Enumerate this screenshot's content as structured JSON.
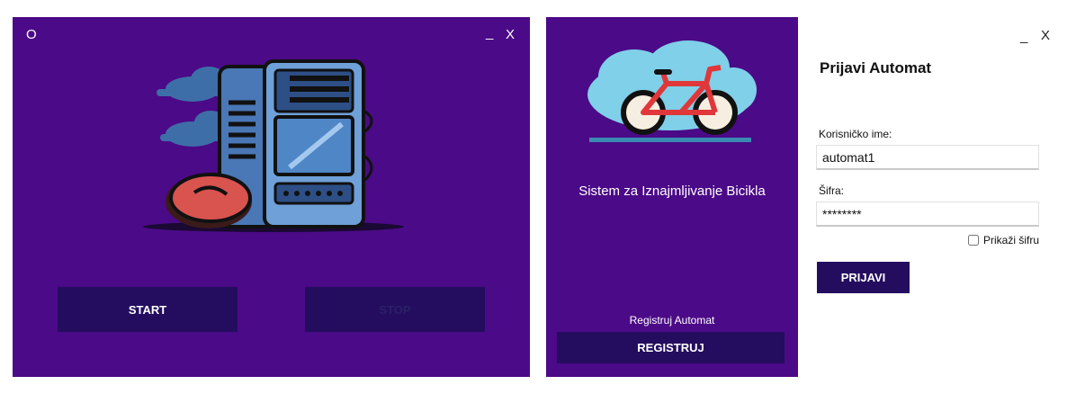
{
  "server_window": {
    "icon_label": "O",
    "minimize": "_",
    "close": "X",
    "start_label": "START",
    "stop_label": "STOP"
  },
  "brand_panel": {
    "title": "Sistem za Iznajmljivanje Bicikla",
    "register_caption": "Registruj Automat",
    "register_button": "REGISTRUJ"
  },
  "login": {
    "minimize": "_",
    "close": "X",
    "heading": "Prijavi Automat",
    "username_label": "Korisničko ime:",
    "username_value": "automat1",
    "password_label": "Šifra:",
    "password_value": "********",
    "show_password_label": "Prikaži šifru",
    "show_password_checked": false,
    "submit_label": "PRIJAVI"
  },
  "colors": {
    "panel_purple": "#4b0a87",
    "button_dark": "#240d5f",
    "white": "#ffffff"
  }
}
